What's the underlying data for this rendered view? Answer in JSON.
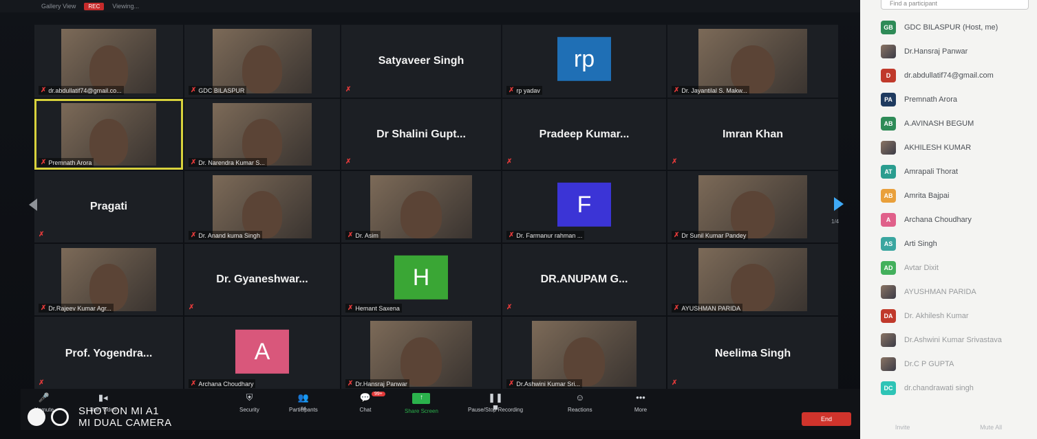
{
  "topbar": {
    "view": "Gallery View",
    "rec": "REC",
    "extra": "Viewing..."
  },
  "tiles": [
    {
      "label": "dr.abdullatif74@gmail.co...",
      "kind": "video"
    },
    {
      "label": "GDC BILASPUR",
      "kind": "video"
    },
    {
      "name": "Satyaveer Singh",
      "kind": "name"
    },
    {
      "label": "rp yadav",
      "avatar": "rp",
      "avatar_color": "#1f6fb5",
      "kind": "avatar"
    },
    {
      "label": "Dr. Jayantilal S. Makw...",
      "kind": "video"
    },
    {
      "label": "Premnath Arora",
      "kind": "video",
      "speaking": true
    },
    {
      "label": "Dr. Narendra Kumar S...",
      "kind": "video"
    },
    {
      "name": "Dr Shalini Gupt...",
      "kind": "name"
    },
    {
      "name": "Pradeep Kumar...",
      "kind": "name"
    },
    {
      "name": "Imran Khan",
      "kind": "name"
    },
    {
      "name": "Pragati",
      "kind": "name"
    },
    {
      "label": "Dr. Anand kuma Singh",
      "kind": "video"
    },
    {
      "label": "Dr. Asim",
      "kind": "video"
    },
    {
      "label": "Dr. Farmanur rahman ...",
      "avatar": "F",
      "avatar_color": "#3b34d6",
      "kind": "avatar"
    },
    {
      "label": "Dr Sunil Kumar Pandey",
      "kind": "video"
    },
    {
      "label": "Dr.Rajeev Kumar Agr...",
      "kind": "video"
    },
    {
      "name": "Dr. Gyaneshwar...",
      "kind": "name"
    },
    {
      "label": "Hemant Saxena",
      "avatar": "H",
      "avatar_color": "#3aa635",
      "kind": "avatar"
    },
    {
      "name": "DR.ANUPAM G...",
      "kind": "name"
    },
    {
      "label": "AYUSHMAN PARIDA",
      "kind": "video"
    },
    {
      "name": "Prof. Yogendra...",
      "kind": "name"
    },
    {
      "label": "Archana Choudhary",
      "avatar": "A",
      "avatar_color": "#d9577b",
      "kind": "avatar"
    },
    {
      "label": "Dr.Hansraj Panwar",
      "kind": "video"
    },
    {
      "label": "Dr.Ashwini Kumar Sri...",
      "kind": "video"
    },
    {
      "name": "Neelima Singh",
      "kind": "name"
    }
  ],
  "pagination": "1/4",
  "toolbar": {
    "unmute": "Unmute",
    "start_video": "Start Video",
    "security": "Security",
    "participants": "Participants",
    "participants_count": "64",
    "chat": "Chat",
    "chat_badge": "99+",
    "share_screen": "Share Screen",
    "recording": "Pause/Stop Recording",
    "reactions": "Reactions",
    "more": "More",
    "end": "End"
  },
  "watermark": {
    "line1": "SHOT ON MI A1",
    "line2": "MI DUAL CAMERA"
  },
  "participants_panel": {
    "search_placeholder": "Find a participant",
    "rows": [
      {
        "initials": "GB",
        "name": "GDC BILASPUR (Host, me)",
        "color": "#2e8b57"
      },
      {
        "initials": "",
        "name": "Dr.Hansraj Panwar",
        "color": ""
      },
      {
        "initials": "D",
        "name": "dr.abdullatif74@gmail.com",
        "color": "#c0392b"
      },
      {
        "initials": "PA",
        "name": "Premnath Arora",
        "color": "#1f3a5f"
      },
      {
        "initials": "AB",
        "name": "A.AVINASH BEGUM",
        "color": "#2e8b57"
      },
      {
        "initials": "",
        "name": "AKHILESH KUMAR",
        "color": ""
      },
      {
        "initials": "AT",
        "name": "Amrapali Thorat",
        "color": "#2a9d8f"
      },
      {
        "initials": "AB",
        "name": "Amrita Bajpai",
        "color": "#e9a03b"
      },
      {
        "initials": "A",
        "name": "Archana Choudhary",
        "color": "#e0608a"
      },
      {
        "initials": "AS",
        "name": "Arti Singh",
        "color": "#3aa6a0"
      },
      {
        "initials": "AD",
        "name": "Avtar Dixit",
        "color": "#43b05c"
      },
      {
        "initials": "",
        "name": "AYUSHMAN PARIDA",
        "color": ""
      },
      {
        "initials": "DA",
        "name": "Dr. Akhilesh Kumar",
        "color": "#c0392b"
      },
      {
        "initials": "",
        "name": "Dr.Ashwini Kumar Srivastava",
        "color": ""
      },
      {
        "initials": "",
        "name": "Dr.C P GUPTA",
        "color": ""
      },
      {
        "initials": "DC",
        "name": "dr.chandrawati singh",
        "color": "#2ec4b6"
      }
    ],
    "invite": "Invite",
    "mute_all": "Mute All"
  }
}
